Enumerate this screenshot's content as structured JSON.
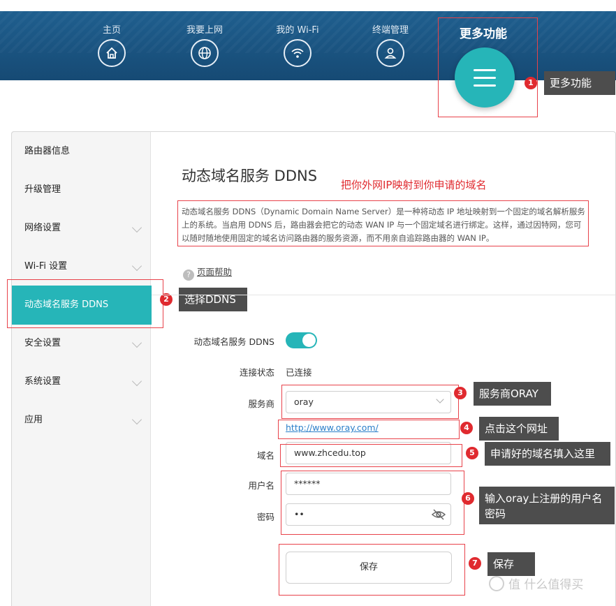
{
  "nav": {
    "items": [
      {
        "label": "主页",
        "icon": "home-icon"
      },
      {
        "label": "我要上网",
        "icon": "globe-icon"
      },
      {
        "label": "我的 Wi-Fi",
        "icon": "wifi-icon"
      },
      {
        "label": "终端管理",
        "icon": "user-icon"
      }
    ],
    "more_label": "更多功能",
    "more_icon": "menu-icon"
  },
  "sidebar": {
    "items": [
      {
        "label": "路由器信息",
        "chevron": false
      },
      {
        "label": "升级管理",
        "chevron": false
      },
      {
        "label": "网络设置",
        "chevron": true
      },
      {
        "label": "Wi-Fi 设置",
        "chevron": true
      },
      {
        "label": "动态域名服务 DDNS",
        "chevron": false,
        "active": true
      },
      {
        "label": "安全设置",
        "chevron": true
      },
      {
        "label": "系统设置",
        "chevron": true
      },
      {
        "label": "应用",
        "chevron": true
      }
    ]
  },
  "main": {
    "title": "动态域名服务 DDNS",
    "description": "动态域名服务 DDNS（Dynamic Domain Name Server）是一种将动态 IP 地址映射到一个固定的域名解析服务上的系统。当启用 DDNS 后，路由器会把它的动态 WAN IP 与一个固定域名进行绑定。这样，通过因特网，您可以随时随地使用固定的域名访问路由器的服务资源，而不用亲自追踪路由器的 WAN IP。",
    "help_link": "页面帮助",
    "form": {
      "ddns_label": "动态域名服务 DDNS",
      "ddns_enabled": true,
      "status_label": "连接状态",
      "status_value": "已连接",
      "provider_label": "服务商",
      "provider_value": "oray",
      "provider_url": "http://www.oray.com/",
      "domain_label": "域名",
      "domain_value": "www.zhcedu.top",
      "username_label": "用户名",
      "username_value": "******",
      "password_label": "密码",
      "password_value": "••",
      "save_label": "保存"
    }
  },
  "annotations": {
    "note_main": "把你外网IP映射到你申请的域名",
    "callouts": [
      {
        "num": "1",
        "text": "更多功能"
      },
      {
        "num": "2",
        "text": "选择DDNS"
      },
      {
        "num": "3",
        "text": "服务商ORAY"
      },
      {
        "num": "4",
        "text": "点击这个网址"
      },
      {
        "num": "5",
        "text": "申请好的域名填入这里"
      },
      {
        "num": "6",
        "text": "输入oray上注册的用户名密码"
      },
      {
        "num": "7",
        "text": "保存"
      }
    ],
    "color": "#e02a2f"
  },
  "watermark": "值 什么值得买",
  "colors": {
    "accent": "#26b5b8",
    "header": "#1b5684",
    "link": "#2a7fc9"
  }
}
